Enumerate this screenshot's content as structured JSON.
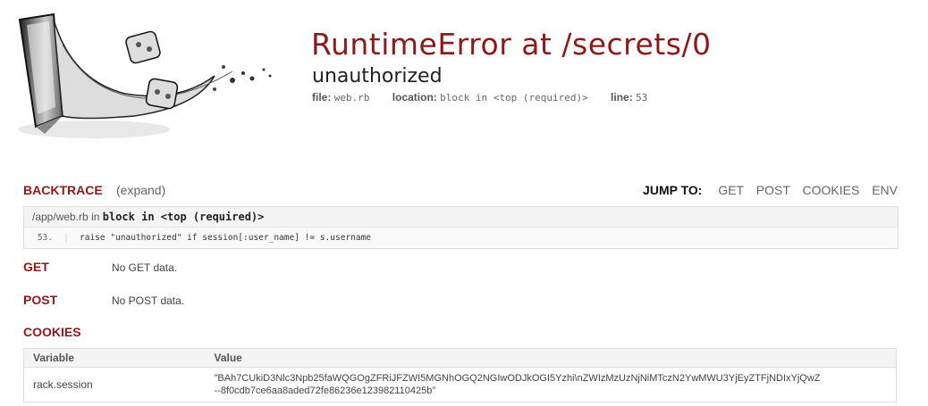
{
  "header": {
    "title": "RuntimeError at /secrets/0",
    "subtitle": "unauthorized",
    "file_label": "file:",
    "file_value": "web.rb",
    "location_label": "location:",
    "location_value": "block in <top (required)>",
    "line_label": "line:",
    "line_value": "53"
  },
  "backtrace": {
    "title": "BACKTRACE",
    "expand_label": "(expand)",
    "jump_label": "JUMP TO:",
    "jump_links": [
      "GET",
      "POST",
      "COOKIES",
      "ENV"
    ],
    "frame_file": "/app/web.rb",
    "frame_in": "in",
    "frame_method": "block in <top (required)>",
    "line_number": "53.",
    "line_code": "raise \"unauthorized\" if session[:user_name] != s.username"
  },
  "get": {
    "title": "GET",
    "note": "No GET data."
  },
  "post": {
    "title": "POST",
    "note": "No POST data."
  },
  "cookies": {
    "title": "COOKIES",
    "col_variable": "Variable",
    "col_value": "Value",
    "rows": [
      {
        "variable": "rack.session",
        "value_line1": "\"BAh7CUkiD3Nlc3Npb25faWQGOgZFRiJFZWI5MGNhOGQ2NGIwODJkOGI5Yzhi\\nZWIzMzUzNjNiMTczN2YwMWU3YjEyZTFjNDIxYjQwZ",
        "value_line2": "--8f0cdb7ce6aa8aded72fe86236e123982110425b\""
      }
    ]
  },
  "colors": {
    "accent": "#8b1a1a",
    "muted": "#666666",
    "box_bg": "#f4f4f4"
  }
}
